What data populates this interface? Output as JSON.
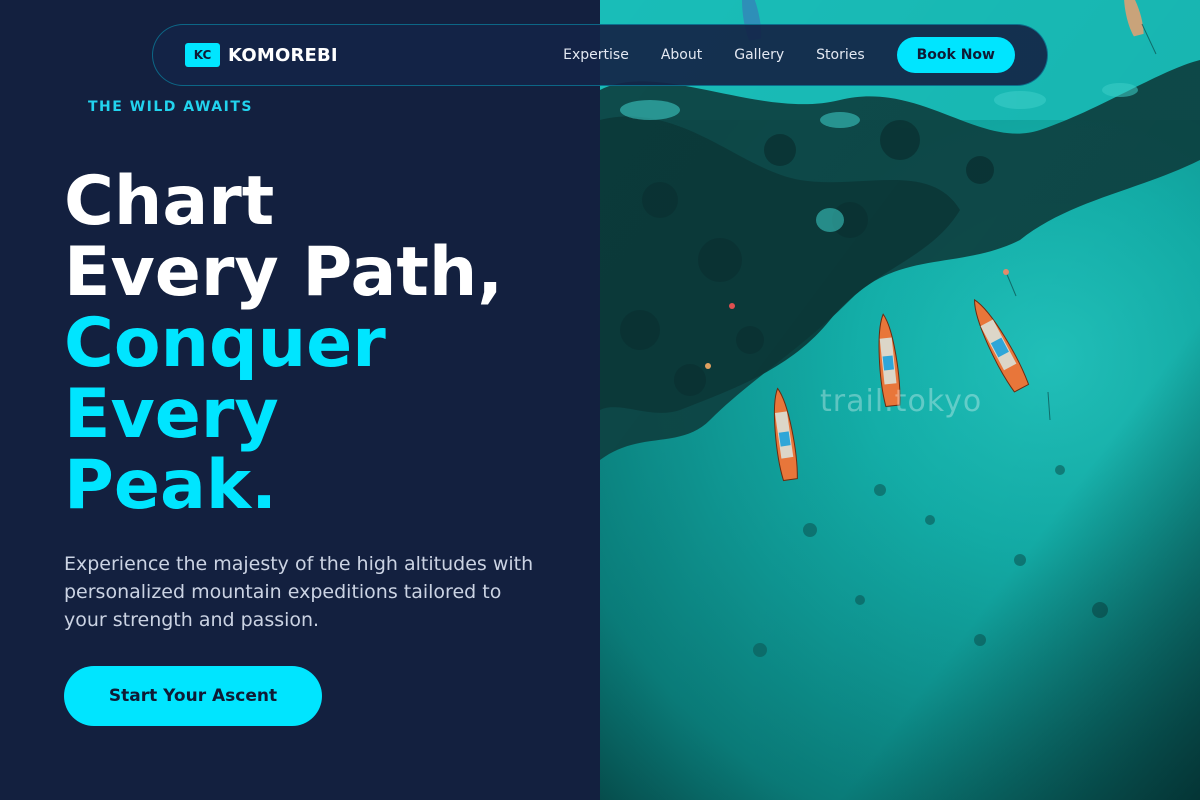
{
  "brand": {
    "badge": "KC",
    "name": "KOMOREBI"
  },
  "nav": {
    "links": [
      "Expertise",
      "About",
      "Gallery",
      "Stories"
    ],
    "cta": "Book Now"
  },
  "hero": {
    "eyebrow": "THE WILD AWAITS",
    "headline": {
      "line1": "Chart",
      "line2": "Every Path,",
      "line3": "Conquer",
      "line4": "Every",
      "line5": "Peak."
    },
    "description": "Experience the majesty of the high altitudes with personalized mountain expeditions tailored to your strength and passion.",
    "cta": "Start Your Ascent"
  },
  "image": {
    "watermark": "trail.tokyo",
    "subject": "aerial view of boats on turquoise sea over coral reef"
  },
  "colors": {
    "background": "#13203f",
    "accent": "#00e5ff",
    "text": "#ffffff",
    "muted": "#cbd3e3"
  }
}
